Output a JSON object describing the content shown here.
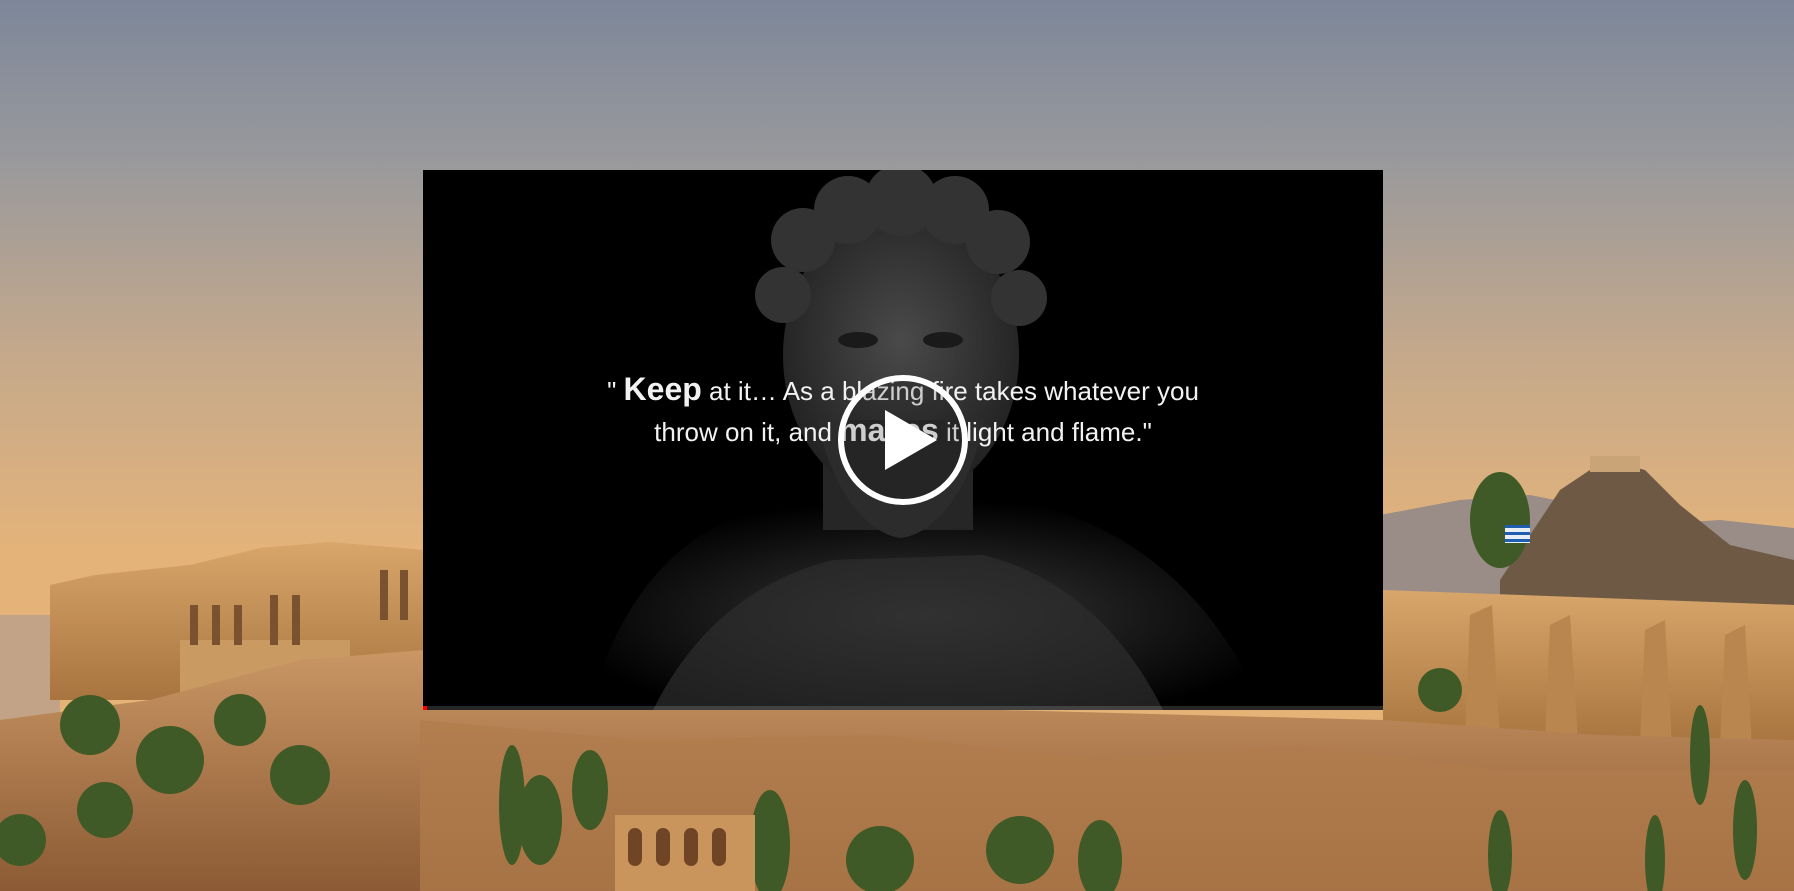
{
  "background": {
    "scene": "acropolis-athens-sunset",
    "sky_top_color": "#7d879a",
    "sky_bottom_color": "#e8b374"
  },
  "video": {
    "quote": {
      "open_quote": "\" ",
      "emph1": "Keep",
      "part1": " at it… As a blazing fire takes whatever you throw on it, and ",
      "emph2": "makes",
      "part2": " it light and flame.\""
    },
    "play_icon": "play-icon",
    "progress_fraction": 0.004,
    "progress_color": "#ff0000"
  }
}
